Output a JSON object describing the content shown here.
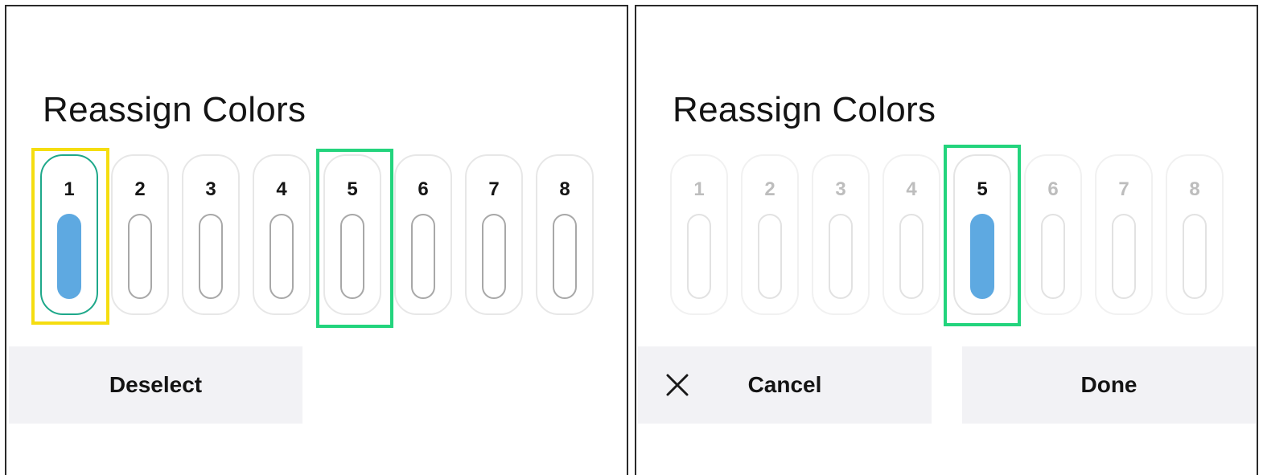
{
  "left": {
    "title": "Reassign Colors",
    "slots": [
      "1",
      "2",
      "3",
      "4",
      "5",
      "6",
      "7",
      "8"
    ],
    "selected_slot": "1",
    "deselect_label": "Deselect"
  },
  "right": {
    "title": "Reassign Colors",
    "slots": [
      "1",
      "2",
      "3",
      "4",
      "5",
      "6",
      "7",
      "8"
    ],
    "selected_slot": "5",
    "cancel_label": "Cancel",
    "done_label": "Done"
  },
  "colors": {
    "fill_blue": "#5ea9e1",
    "ring_teal": "#1ea88a",
    "highlight_yellow": "#f5dd10",
    "highlight_green": "#23d47d"
  },
  "icons": {
    "cancel": "close-icon"
  }
}
